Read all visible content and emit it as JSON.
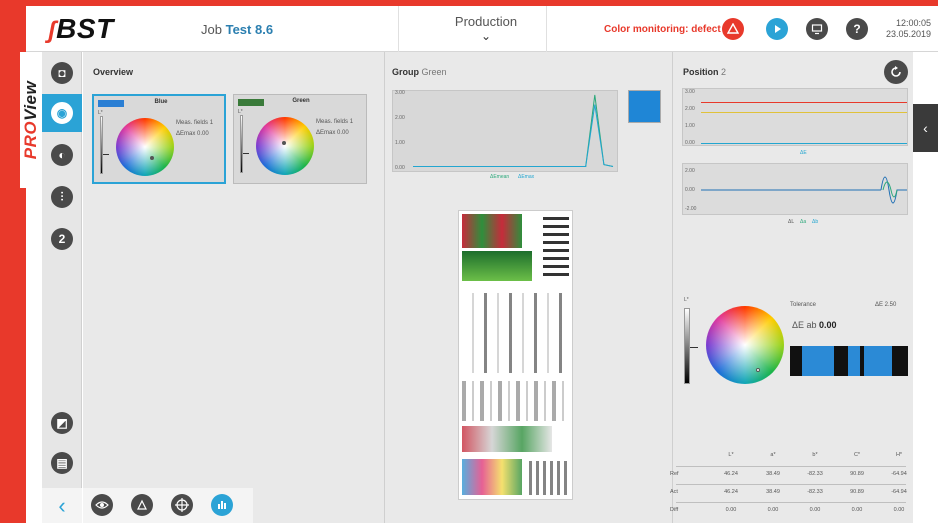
{
  "brand": {
    "logo_text": "BST",
    "proview_pro": "PRO",
    "proview_view": "View"
  },
  "header": {
    "job_label": "Job",
    "job_name": "Test 8.6",
    "view_menu": "Production",
    "status_text": "Color monitoring: defect",
    "time": "12:00:05",
    "date": "23.05.2019",
    "icons": [
      "warning-triangle-icon",
      "play-icon",
      "monitor-icon",
      "help-icon"
    ],
    "status_color": "#e8392b",
    "accent_color": "#2ba3d6"
  },
  "sidebar": {
    "items": [
      {
        "icon": "camera-icon",
        "active": false
      },
      {
        "icon": "spectral-icon",
        "active": true
      },
      {
        "icon": "contrast-icon",
        "active": false
      },
      {
        "icon": "sliders-icon",
        "active": false
      },
      {
        "icon": "number-2-icon",
        "label": "2",
        "active": false
      },
      {
        "icon": "image-edit-icon",
        "active": false
      },
      {
        "icon": "report-icon",
        "active": false
      }
    ]
  },
  "bottom_toolbar": {
    "icons": [
      "back-chevron-icon",
      "eye-icon",
      "drop-icon",
      "crosshair-icon",
      "chart-icon"
    ],
    "back_glyph": "‹"
  },
  "overview": {
    "title": "Overview",
    "cards": [
      {
        "name": "Blue",
        "swatch": "#2b7fd4",
        "meas_label": "Meas. fields",
        "meas_value": "1",
        "emax_label": "ΔEmax",
        "emax_value": "0.00",
        "selected": true,
        "l_label": "L*"
      },
      {
        "name": "Green",
        "swatch": "#3a7a3a",
        "meas_label": "Meas. fields",
        "meas_value": "1",
        "emax_label": "ΔEmax",
        "emax_value": "0.00",
        "selected": false,
        "l_label": "L*"
      }
    ]
  },
  "group": {
    "title": "Group",
    "name": "Green",
    "swatch": "#1f86d6",
    "chart_data": {
      "type": "line",
      "yticks": [
        "3.00",
        "2.00",
        "1.00",
        "0.00"
      ],
      "ylim": [
        0,
        3
      ],
      "series": [
        {
          "name": "ΔEmean",
          "color": "#2ba87a",
          "values": [
            0.02,
            0.02,
            0.02,
            0.02,
            0.02,
            0.02,
            0.02,
            0.02,
            0.02,
            0.02,
            0.02,
            0.02,
            0.02,
            0.02,
            0.02,
            0.02,
            0.02,
            0.02,
            0.02,
            0.02,
            3.0,
            0.1,
            0.02
          ]
        },
        {
          "name": "ΔEmax",
          "color": "#23a6d0",
          "values": [
            0.02,
            0.02,
            0.02,
            0.02,
            0.02,
            0.02,
            0.02,
            0.02,
            0.02,
            0.02,
            0.02,
            0.02,
            0.02,
            0.02,
            0.02,
            0.02,
            0.02,
            0.02,
            0.02,
            0.02,
            2.6,
            0.1,
            0.02
          ]
        }
      ]
    }
  },
  "position": {
    "title": "Position",
    "number": "2",
    "chart_de": {
      "yticks": [
        "3.00",
        "2.00",
        "1.00",
        "0.00"
      ],
      "legend": "ΔE",
      "tolerance_lines": [
        {
          "value": 2.5,
          "color": "#e8392b"
        },
        {
          "value": 2.0,
          "color": "#e0c23a"
        }
      ]
    },
    "chart_lab": {
      "yticks": [
        "2.00",
        "0.00",
        "-2.00"
      ],
      "legend": [
        "ΔL",
        "Δa",
        "Δb"
      ]
    },
    "l_label": "L*",
    "tolerance_label": "Tolerance",
    "tolerance_value_label": "ΔE 2.50",
    "de_ab_label": "ΔE ab",
    "de_ab_value": "0.00",
    "table": {
      "columns": [
        "",
        "L*",
        "a*",
        "b*",
        "C*",
        "H*"
      ],
      "rows": [
        {
          "label": "Ref",
          "values": [
            "46.24",
            "38.49",
            "-82.33",
            "90.89",
            "-64.94"
          ]
        },
        {
          "label": "Act",
          "values": [
            "46.24",
            "38.49",
            "-82.33",
            "90.89",
            "-64.94"
          ]
        },
        {
          "label": "Diff",
          "values": [
            "0.00",
            "0.00",
            "0.00",
            "0.00",
            "0.00"
          ]
        }
      ]
    }
  }
}
